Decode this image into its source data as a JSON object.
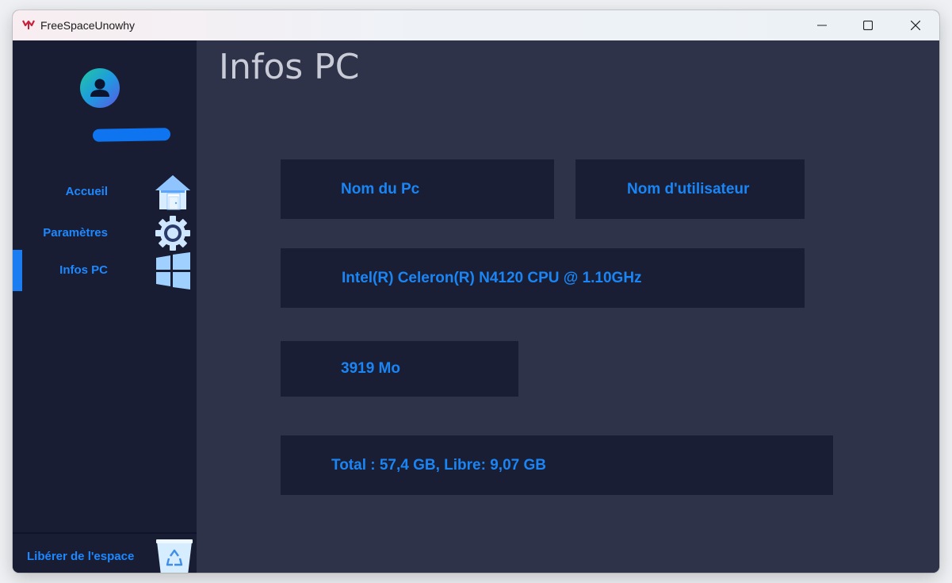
{
  "window": {
    "title": "FreeSpaceUnowhy",
    "controls": {
      "minimize_icon": "minimize-icon",
      "maximize_icon": "maximize-icon",
      "close_icon": "close-icon"
    }
  },
  "sidebar": {
    "avatar_icon": "user-avatar-icon",
    "username": "",
    "items": [
      {
        "label": "Accueil",
        "icon": "house-icon",
        "active": false
      },
      {
        "label": "Paramètres",
        "icon": "gear-icon",
        "active": false
      },
      {
        "label": "Infos PC",
        "icon": "windows-logo-icon",
        "active": true
      }
    ],
    "free_space": {
      "label": "Libérer de l'espace",
      "icon": "recycle-bin-icon"
    }
  },
  "main": {
    "title": "Infos PC",
    "pc_name_label": "Nom du Pc",
    "username_label": "Nom d'utilisateur",
    "cpu": "Intel(R) Celeron(R) N4120 CPU @ 1.10GHz",
    "ram": "3919 Mo",
    "disk": "Total : 57,4 GB, Libre: 9,07 GB"
  },
  "colors": {
    "sidebar_bg": "#181d34",
    "main_bg": "#2e3349",
    "card_bg": "#191e35",
    "accent": "#1e88ff",
    "title_text": "#c9ccd6"
  }
}
